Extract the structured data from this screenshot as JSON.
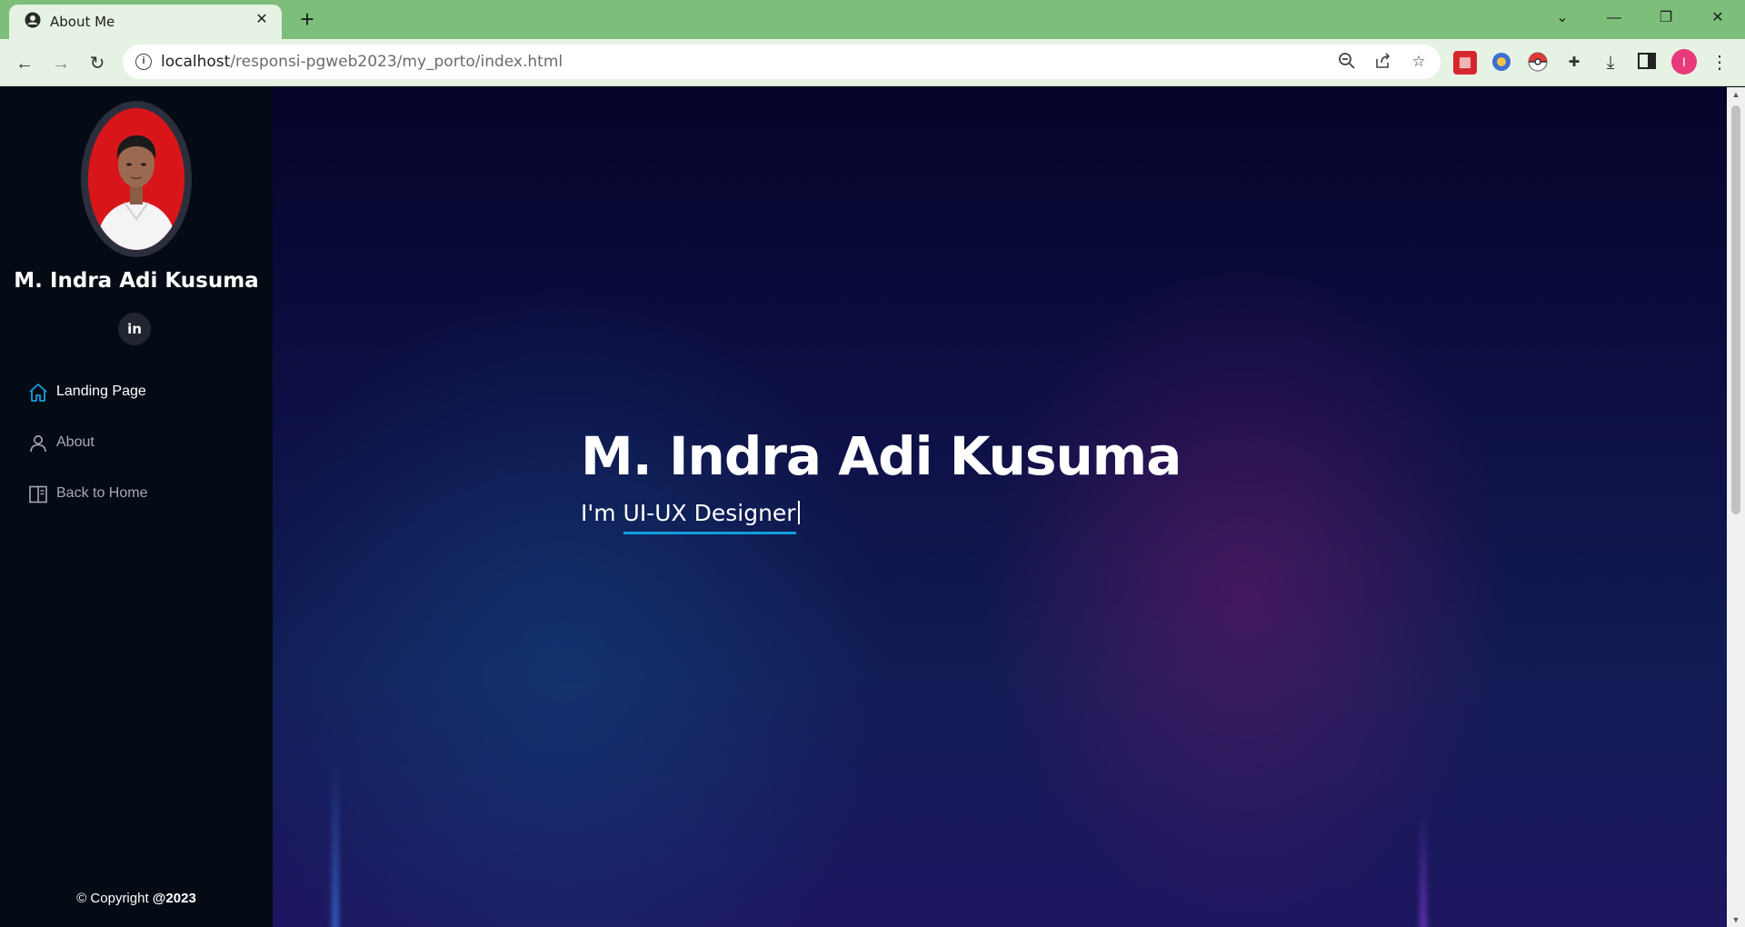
{
  "browser": {
    "tab_title": "About Me",
    "url_host": "localhost",
    "url_path": "/responsi-pgweb2023/my_porto/index.html",
    "profile_initial": "I"
  },
  "sidebar": {
    "name": "M. Indra Adi Kusuma",
    "social_icon_text": "in",
    "nav": [
      {
        "label": "Landing Page",
        "icon": "home-icon",
        "active": true
      },
      {
        "label": "About",
        "icon": "person-icon",
        "active": false
      },
      {
        "label": "Back to Home",
        "icon": "layout-icon",
        "active": false
      }
    ],
    "copyright_prefix": "© Copyright ",
    "copyright_year": "@2023"
  },
  "hero": {
    "title": "M. Indra Adi Kusuma",
    "subtitle_prefix": "I'm ",
    "subtitle_typed": "UI-UX Designer"
  },
  "colors": {
    "accent": "#149ddd",
    "sidebar_bg": "#040b14",
    "tabstrip": "#7dbf7a"
  }
}
